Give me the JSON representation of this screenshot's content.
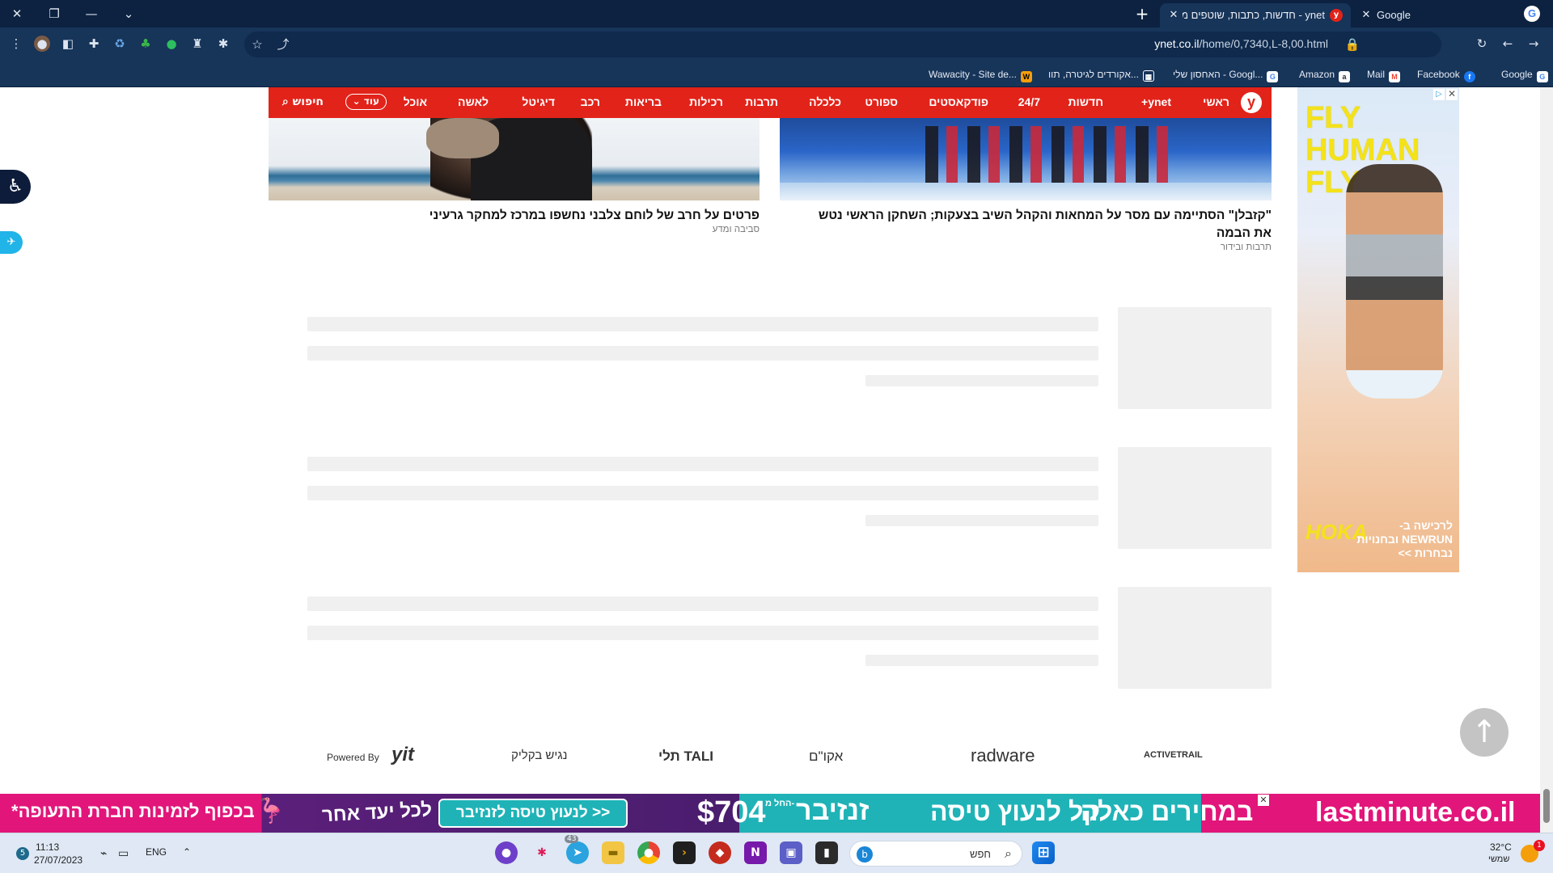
{
  "browser": {
    "window_controls": {
      "close": "✕",
      "restore": "❐",
      "minimize": "—",
      "menu": "⌄"
    },
    "tabs": [
      {
        "title": "ynet - חדשות, כתבות, שוטפים מהארץ ומהעולם",
        "favicon": "y",
        "active": true
      },
      {
        "title": "Google",
        "favicon": "G",
        "active": false
      }
    ],
    "url_host": "ynet.co.il",
    "url_path": "/home/0,7340,L-8,00.html",
    "bookmarks": [
      {
        "label": "Google",
        "icon": "G",
        "color": "#ffffff"
      },
      {
        "label": "Facebook",
        "icon": "f",
        "color": "#1877f2"
      },
      {
        "label": "Mail",
        "icon": "M",
        "color": "#ea4335"
      },
      {
        "label": "Amazon",
        "icon": "a",
        "color": "#232f3e"
      },
      {
        "label": "האחסון שלי - Googl...",
        "icon": "G",
        "color": "#ffffff"
      },
      {
        "label": "אקורדים לגיטרה, תוו...",
        "icon": "▦",
        "color": "#555555"
      },
      {
        "label": "Wawacity - Site de...",
        "icon": "W",
        "color": "#f59e0b"
      }
    ]
  },
  "nav": {
    "logo": "y",
    "items": [
      "ראשי",
      "ynet+",
      "חדשות",
      "24/7",
      "פודקאסטים",
      "ספורט",
      "כלכלה",
      "תרבות",
      "רכילות",
      "בריאות",
      "רכב",
      "דיגיטל",
      "לאשה",
      "אוכל"
    ],
    "more": "עוד",
    "search": "חיפוש"
  },
  "articles": [
    {
      "headline": "\"קזבלן\" הסתיימה עם מסר על המחאות והקהל השיב בצעקות; השחקן הראשי נטש את הבמה",
      "category": "תרבות ובידור"
    },
    {
      "headline": "פרטים על חרב של לוחם צלבני נחשפו במרכז למחקר גרעיני",
      "category": "סביבה ומדע"
    }
  ],
  "side_ad": {
    "title": "FLY HUMAN FLY",
    "brand": "HOKA",
    "cta": "לרכישה ב- NEWRUN ובחנויות נבחרות >>"
  },
  "footer_logos": [
    "Powered By",
    "yit",
    "נגיש בקליק",
    "תלי TALI",
    "אקו\"ם",
    "radware",
    "ACTIVETRAIL"
  ],
  "bottom_ad": {
    "brand": "lastminute.co.il",
    "text1": "במחירים כאלה",
    "text2": "קל לנעוץ טיסה",
    "price_label": "זנזיבר",
    "price_prefix": "החל מ-",
    "price": "$704",
    "cta": "לנעוץ טיסה לזנזיבר >>",
    "tagline": "או לכל יעד אחר",
    "note": "*בכפוף לזמינות חברת התעופה"
  },
  "taskbar": {
    "time": "11:13",
    "date": "27/07/2023",
    "lang": "ENG",
    "weather": "32°C",
    "weather_sub": "שמשי",
    "search_placeholder": "חפש",
    "notification_count": "1",
    "telegram_badge": "43",
    "widget_badge": "5"
  }
}
